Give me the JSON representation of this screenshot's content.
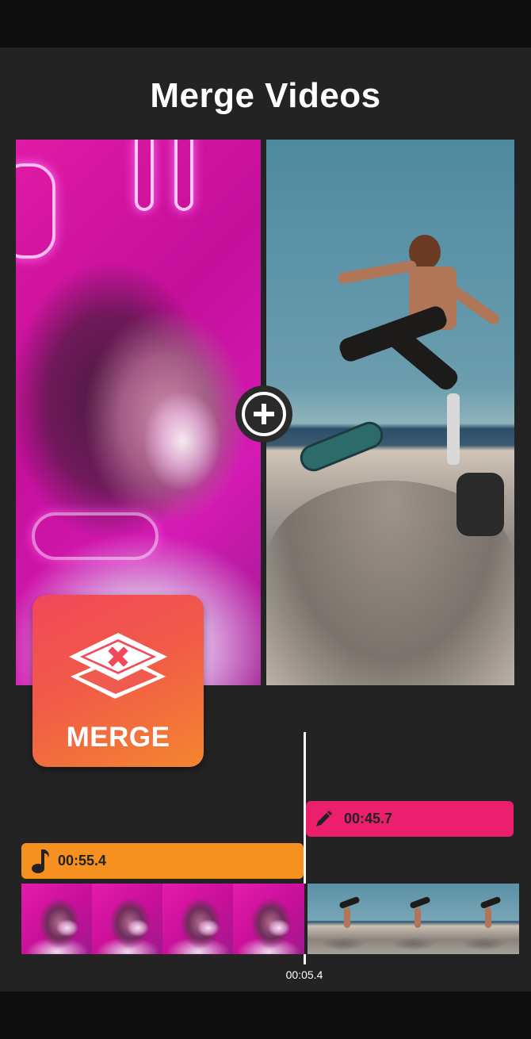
{
  "header": {
    "title": "Merge Videos"
  },
  "preview": {
    "left_clip_name": "neon-portrait-clip",
    "right_clip_name": "skateboard-clip",
    "add_icon": "plus-circle-icon"
  },
  "badge": {
    "label": "MERGE",
    "icon": "film-merge-icon"
  },
  "timeline": {
    "text_clip": {
      "icon": "pencil-icon",
      "duration": "00:45.7",
      "color": "#ec1f6e"
    },
    "music_clip": {
      "icon": "music-note-icon",
      "duration": "00:55.4",
      "color": "#f6911f"
    },
    "playhead_time": "00:05.4",
    "thumbnails": [
      "neon-portrait",
      "neon-portrait",
      "neon-portrait",
      "neon-portrait",
      "skateboard",
      "skateboard",
      "skateboard"
    ]
  },
  "colors": {
    "background": "#242324",
    "accent_pink": "#ec1f6e",
    "accent_orange": "#f6911f"
  }
}
